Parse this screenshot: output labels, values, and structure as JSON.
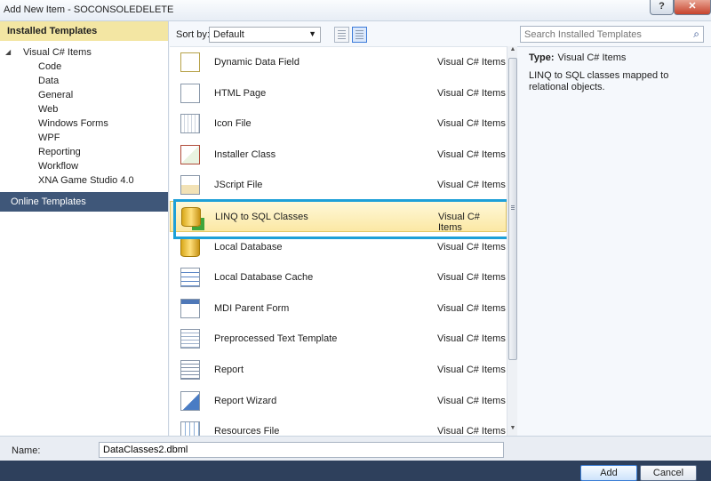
{
  "window": {
    "title": "Add New Item - SOCONSOLEDELETE",
    "help_label": "?",
    "close_label": "✕"
  },
  "left": {
    "header": "Installed Templates",
    "root": "Visual C# Items",
    "items": [
      "Code",
      "Data",
      "General",
      "Web",
      "Windows Forms",
      "WPF",
      "Reporting",
      "Workflow",
      "XNA Game Studio 4.0"
    ],
    "online": "Online Templates"
  },
  "toolbar": {
    "sort_label": "Sort by:",
    "sort_value": "Default"
  },
  "templates": [
    {
      "name": "Dynamic Data Field",
      "category": "Visual C# Items",
      "icon": "dynamic-data-icon"
    },
    {
      "name": "HTML Page",
      "category": "Visual C# Items",
      "icon": "html-page-icon"
    },
    {
      "name": "Icon File",
      "category": "Visual C# Items",
      "icon": "icon-file-icon"
    },
    {
      "name": "Installer Class",
      "category": "Visual C# Items",
      "icon": "installer-icon"
    },
    {
      "name": "JScript File",
      "category": "Visual C# Items",
      "icon": "jscript-icon"
    },
    {
      "name": "LINQ to SQL Classes",
      "category": "Visual C# Items",
      "icon": "linq-icon",
      "selected": true
    },
    {
      "name": "Local Database",
      "category": "Visual C# Items",
      "icon": "database-icon"
    },
    {
      "name": "Local Database Cache",
      "category": "Visual C# Items",
      "icon": "database-cache-icon"
    },
    {
      "name": "MDI Parent Form",
      "category": "Visual C# Items",
      "icon": "mdi-form-icon"
    },
    {
      "name": "Preprocessed Text Template",
      "category": "Visual C# Items",
      "icon": "text-template-icon"
    },
    {
      "name": "Report",
      "category": "Visual C# Items",
      "icon": "report-icon"
    },
    {
      "name": "Report Wizard",
      "category": "Visual C# Items",
      "icon": "report-wizard-icon"
    },
    {
      "name": "Resources File",
      "category": "Visual C# Items",
      "icon": "resources-icon"
    }
  ],
  "right": {
    "search_placeholder": "Search Installed Templates",
    "type_label": "Type:",
    "type_value": "Visual C# Items",
    "description": "LINQ to SQL classes mapped to relational objects."
  },
  "name_field": {
    "label": "Name:",
    "value": "DataClasses2.dbml"
  },
  "buttons": {
    "add": "Add",
    "cancel": "Cancel"
  }
}
